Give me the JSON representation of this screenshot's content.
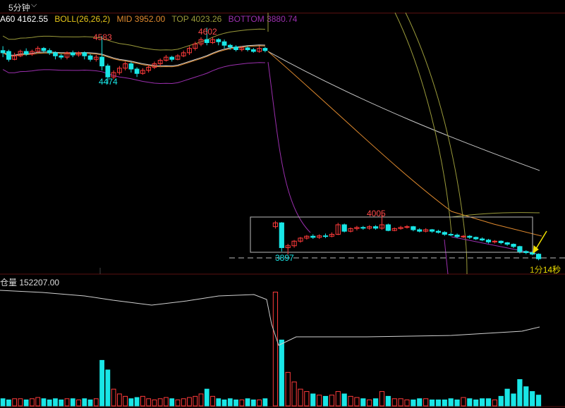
{
  "toolbar": {
    "period": "5分钟",
    "chevron_icon": "chevron-down-icon"
  },
  "legend": {
    "ma_label": "A60 4162.55",
    "boll_label": "BOLL(26,26,2)",
    "mid_label": "MID 3952.00",
    "top_label": "TOP 4023.26",
    "bottom_label": "BOTTOM 3880.74",
    "colors": {
      "ma": "#ffffff",
      "boll": "#e6c619",
      "mid": "#e08a2e",
      "top": "#9a9a3a",
      "bottom": "#9b2fae"
    }
  },
  "annotations": {
    "high_left": "4583",
    "low_left": "4474",
    "high_mid": "4602",
    "high_right": "4005",
    "low_right": "3897",
    "countdown_a": "1分",
    "countdown_b": "14秒"
  },
  "volume_panel": {
    "label": "仓量 152207.00"
  },
  "colors": {
    "up": "#ff3b3b",
    "down": "#19e6e6",
    "ma": "#d0d0d0",
    "arrow": "#f0e000",
    "grid": "#5a1010"
  },
  "chart_data": [
    {
      "type": "candlestick",
      "title": "",
      "series": [
        {
          "name": "K",
          "values": [
            [
              4550,
              4545,
              4560,
              4535
            ],
            [
              4548,
              4530,
              4552,
              4525
            ],
            [
              4530,
              4538,
              4545,
              4528
            ],
            [
              4538,
              4548,
              4552,
              4535
            ],
            [
              4548,
              4542,
              4555,
              4538
            ],
            [
              4542,
              4548,
              4552,
              4538
            ],
            [
              4548,
              4555,
              4560,
              4545
            ],
            [
              4555,
              4550,
              4558,
              4545
            ],
            [
              4550,
              4545,
              4555,
              4540
            ],
            [
              4545,
              4538,
              4548,
              4530
            ],
            [
              4538,
              4535,
              4542,
              4530
            ],
            [
              4535,
              4545,
              4548,
              4530
            ],
            [
              4545,
              4540,
              4550,
              4535
            ],
            [
              4540,
              4545,
              4548,
              4536
            ],
            [
              4545,
              4538,
              4548,
              4530
            ],
            [
              4538,
              4530,
              4542,
              4525
            ],
            [
              4530,
              4535,
              4540,
              4525
            ],
            [
              4535,
              4515,
              4583,
              4505
            ],
            [
              4515,
              4490,
              4520,
              4474
            ],
            [
              4490,
              4500,
              4505,
              4485
            ],
            [
              4500,
              4510,
              4515,
              4495
            ],
            [
              4510,
              4520,
              4525,
              4505
            ],
            [
              4520,
              4508,
              4525,
              4500
            ],
            [
              4508,
              4498,
              4512,
              4490
            ],
            [
              4498,
              4505,
              4510,
              4495
            ],
            [
              4505,
              4512,
              4518,
              4500
            ],
            [
              4512,
              4520,
              4525,
              4508
            ],
            [
              4520,
              4528,
              4532,
              4515
            ],
            [
              4528,
              4535,
              4540,
              4525
            ],
            [
              4535,
              4530,
              4538,
              4525
            ],
            [
              4530,
              4538,
              4542,
              4528
            ],
            [
              4538,
              4545,
              4550,
              4535
            ],
            [
              4545,
              4555,
              4560,
              4540
            ],
            [
              4555,
              4565,
              4570,
              4550
            ],
            [
              4565,
              4575,
              4580,
              4560
            ],
            [
              4575,
              4568,
              4602,
              4562
            ],
            [
              4568,
              4575,
              4580,
              4565
            ],
            [
              4575,
              4570,
              4578,
              4562
            ],
            [
              4570,
              4562,
              4575,
              4555
            ],
            [
              4562,
              4558,
              4565,
              4552
            ],
            [
              4558,
              4552,
              4562,
              4548
            ],
            [
              4552,
              4556,
              4560,
              4548
            ],
            [
              4556,
              4552,
              4560,
              4548
            ],
            [
              4552,
              4548,
              4556,
              4545
            ],
            [
              4548,
              4555,
              4560,
              4545
            ],
            [
              4555,
              4550,
              4558,
              4546
            ],
            [
              3970,
              3980,
              3985,
              3965
            ],
            [
              3980,
              3915,
              3982,
              3905
            ],
            [
              3915,
              3920,
              3925,
              3897
            ],
            [
              3920,
              3932,
              3935,
              3915
            ],
            [
              3932,
              3940,
              3943,
              3928
            ],
            [
              3940,
              3945,
              3948,
              3936
            ],
            [
              3945,
              3942,
              3950,
              3938
            ],
            [
              3942,
              3946,
              3950,
              3938
            ],
            [
              3946,
              3945,
              3952,
              3940
            ],
            [
              3945,
              3950,
              3955,
              3942
            ],
            [
              3950,
              3975,
              3980,
              3948
            ],
            [
              3975,
              3958,
              3978,
              3955
            ],
            [
              3958,
              3965,
              3968,
              3955
            ],
            [
              3965,
              3968,
              3972,
              3960
            ],
            [
              3968,
              3966,
              3972,
              3962
            ],
            [
              3966,
              3970,
              3974,
              3962
            ],
            [
              3970,
              3966,
              3974,
              3962
            ],
            [
              3966,
              3975,
              4005,
              3962
            ],
            [
              3975,
              3960,
              3978,
              3958
            ],
            [
              3960,
              3965,
              3968,
              3958
            ],
            [
              3965,
              3968,
              3972,
              3962
            ],
            [
              3968,
              3970,
              3974,
              3965
            ],
            [
              3970,
              3962,
              3972,
              3958
            ],
            [
              3962,
              3958,
              3966,
              3955
            ],
            [
              3958,
              3962,
              3966,
              3955
            ],
            [
              3962,
              3958,
              3964,
              3954
            ],
            [
              3958,
              3955,
              3962,
              3952
            ],
            [
              3955,
              3950,
              3958,
              3946
            ],
            [
              3950,
              3948,
              3954,
              3945
            ],
            [
              3948,
              3944,
              3952,
              3940
            ],
            [
              3944,
              3945,
              3948,
              3940
            ],
            [
              3945,
              3942,
              3948,
              3938
            ],
            [
              3942,
              3938,
              3944,
              3935
            ],
            [
              3938,
              3935,
              3942,
              3932
            ],
            [
              3935,
              3930,
              3938,
              3926
            ],
            [
              3930,
              3932,
              3935,
              3926
            ],
            [
              3932,
              3928,
              3934,
              3924
            ],
            [
              3928,
              3924,
              3930,
              3920
            ],
            [
              3924,
              3918,
              3926,
              3914
            ],
            [
              3918,
              3905,
              3920,
              3900
            ],
            [
              3905,
              3902,
              3908,
              3898
            ],
            [
              3902,
              3898,
              3904,
              3895
            ],
            [
              3898,
              3886,
              3900,
              3882
            ]
          ]
        }
      ],
      "y_axis_segments": [
        {
          "range": [
            4380,
            4700
          ],
          "note": "left block"
        },
        {
          "range": [
            3860,
            4040
          ],
          "note": "right block"
        }
      ]
    },
    {
      "type": "bar",
      "title": "",
      "series": [
        {
          "name": "volume",
          "values": [
            6,
            5,
            6,
            6,
            5,
            6,
            7,
            6,
            5,
            6,
            5,
            6,
            6,
            5,
            6,
            5,
            6,
            38,
            30,
            14,
            10,
            8,
            6,
            7,
            8,
            6,
            5,
            6,
            7,
            6,
            5,
            6,
            7,
            8,
            10,
            14,
            8,
            6,
            5,
            6,
            5,
            5,
            6,
            5,
            5,
            6,
            95,
            55,
            28,
            20,
            14,
            12,
            10,
            9,
            8,
            9,
            12,
            10,
            8,
            7,
            6,
            5,
            6,
            12,
            8,
            6,
            6,
            5,
            5,
            6,
            6,
            5,
            5,
            5,
            6,
            5,
            7,
            6,
            5,
            6,
            6,
            5,
            8,
            14,
            10,
            22,
            16,
            12,
            9
          ]
        }
      ]
    }
  ]
}
